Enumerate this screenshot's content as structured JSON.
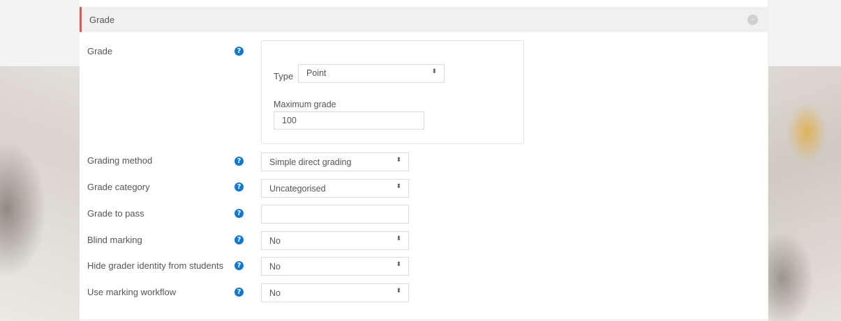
{
  "section": {
    "title": "Grade",
    "collapse_icon": "collapse-icon"
  },
  "grade": {
    "label": "Grade",
    "type_label": "Type",
    "type_value": "Point",
    "max_label": "Maximum grade",
    "max_value": "100"
  },
  "rows": {
    "grading_method": {
      "label": "Grading method",
      "value": "Simple direct grading"
    },
    "grade_category": {
      "label": "Grade category",
      "value": "Uncategorised"
    },
    "grade_to_pass": {
      "label": "Grade to pass",
      "value": ""
    },
    "blind_marking": {
      "label": "Blind marking",
      "value": "No"
    },
    "hide_grader": {
      "label": "Hide grader identity from students",
      "value": "No"
    },
    "marking_workflow": {
      "label": "Use marking workflow",
      "value": "No"
    }
  },
  "icons": {
    "help": "?",
    "select_arrows": "⬍",
    "collapse": "-"
  },
  "colors": {
    "accent": "#e35454",
    "help": "#1177d1"
  }
}
